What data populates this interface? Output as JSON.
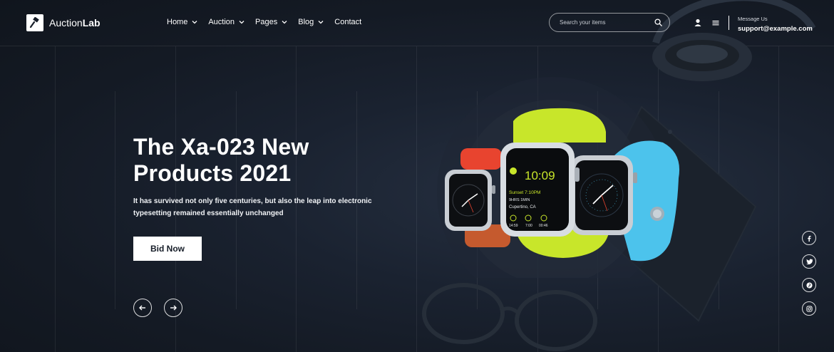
{
  "brand": {
    "name_light": "Auction",
    "name_bold": "Lab",
    "logo_icon": "gavel-icon"
  },
  "nav": {
    "items": [
      {
        "label": "Home",
        "has_dropdown": true
      },
      {
        "label": "Auction",
        "has_dropdown": true
      },
      {
        "label": "Pages",
        "has_dropdown": true
      },
      {
        "label": "Blog",
        "has_dropdown": true
      },
      {
        "label": "Contact",
        "has_dropdown": false
      }
    ]
  },
  "search": {
    "placeholder": "Search your items",
    "value": "",
    "icon": "search-icon"
  },
  "header_icons": {
    "user": "user-icon",
    "menu": "menu-icon"
  },
  "contact": {
    "label": "Message Us",
    "email": "support@example.com"
  },
  "hero": {
    "title": "The Xa-023 New Products 2021",
    "description": "It has survived not only five centuries, but also the leap into electronic typesetting remained essentially unchanged",
    "cta_label": "Bid Now",
    "prev_icon": "arrow-left-icon",
    "next_icon": "arrow-right-icon"
  },
  "watch_screen": {
    "time": "10:09",
    "event": "Sunset 7:10PM",
    "duration": "9HRS 1MIN",
    "location": "Cupertino, CA",
    "complications": [
      "14:59",
      "7:00",
      "00:46"
    ]
  },
  "social": [
    "facebook-icon",
    "twitter-icon",
    "pinterest-icon",
    "instagram-icon"
  ],
  "colors": {
    "background": "#161d28",
    "watch_green": "#c8e62a",
    "watch_blue": "#4cc3ec",
    "watch_red": "#e8442f",
    "screen_text": "#c8e62a"
  }
}
